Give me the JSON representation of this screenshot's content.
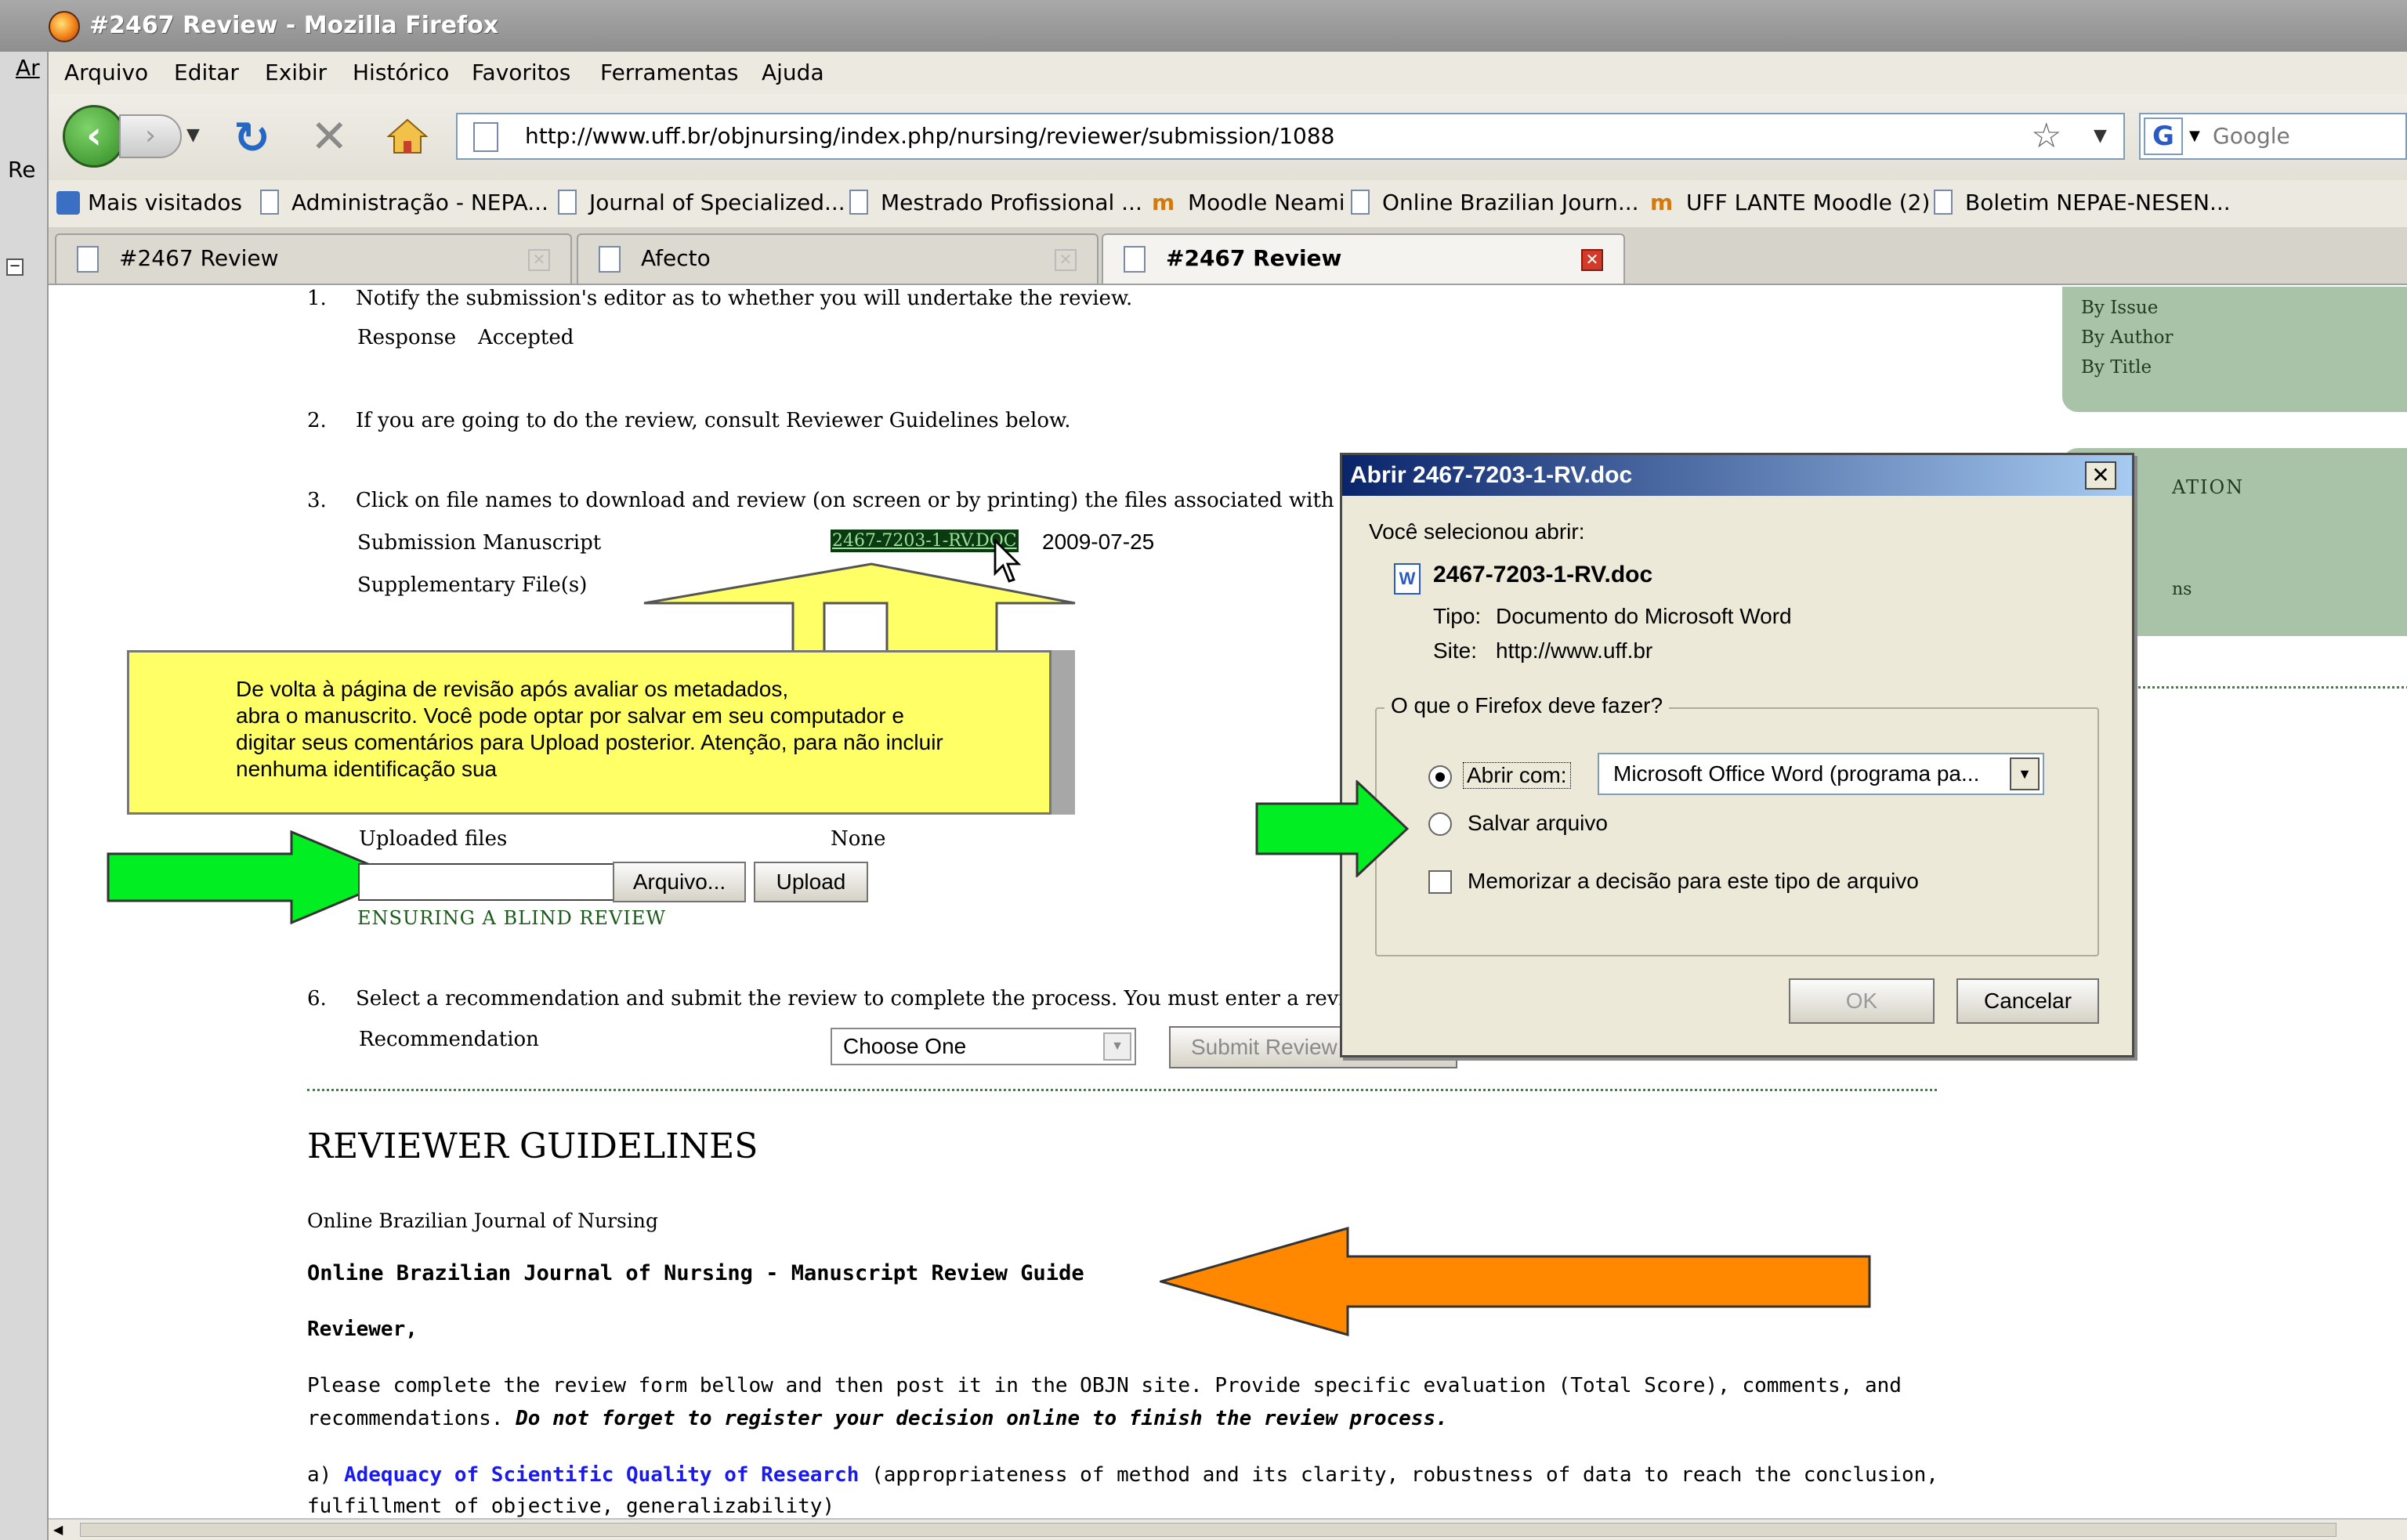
{
  "window": {
    "title": "#2467 Review - Mozilla Firefox"
  },
  "left_strip": {
    "top_label": "Ar",
    "side_label": "Re"
  },
  "menu": [
    "Arquivo",
    "Editar",
    "Exibir",
    "Histórico",
    "Favoritos",
    "Ferramentas",
    "Ajuda"
  ],
  "url": "http://www.uff.br/objnursing/index.php/nursing/reviewer/submission/1088",
  "search": {
    "placeholder": "Google"
  },
  "bookmarks": [
    "Mais visitados",
    "Administração - NEPA...",
    "Journal of Specialized...",
    "Mestrado Profissional ...",
    "Moodle Neami",
    "Online Brazilian Journ...",
    "UFF LANTE Moodle (2)",
    "Boletim NEPAE-NESEN..."
  ],
  "tabs": [
    {
      "label": "#2467 Review",
      "active": false
    },
    {
      "label": "Afecto",
      "active": false
    },
    {
      "label": "#2467 Review",
      "active": true
    }
  ],
  "page": {
    "step1": {
      "num": "1.",
      "text": "Notify the submission's editor as to whether you will undertake the review.",
      "response_label": "Response",
      "response_value": "Accepted"
    },
    "step2": {
      "num": "2.",
      "text": "If you are going to do the review, consult Reviewer Guidelines below."
    },
    "step3": {
      "num": "3.",
      "text": "Click on file names to download and review (on screen or by printing) the files associated with this sub",
      "manuscript_label": "Submission Manuscript",
      "manuscript_file": "2467-7203-1-RV.DOC",
      "manuscript_date": "2009-07-25",
      "supplementary_label": "Supplementary File(s)"
    },
    "callout_text": [
      "De volta à página de revisão após avaliar os metadados,",
      "abra o manuscrito. Você pode optar por salvar em seu computador e",
      "digitar seus comentários para Upload posterior. Atenção, para não incluir",
      "nenhuma identificação sua"
    ],
    "upload": {
      "label": "Uploaded files",
      "value": "None",
      "browse_label": "Arquivo...",
      "upload_label": "Upload",
      "blind_review_link": "ENSURING A BLIND REVIEW"
    },
    "step6": {
      "num": "6.",
      "text": "Select a recommendation and submit the review to complete the process. You must enter a review or u",
      "recommendation_label": "Recommendation",
      "select_value": "Choose One",
      "submit_label": "Submit Review"
    },
    "guidelines": {
      "heading": "REVIEWER GUIDELINES",
      "journal": "Online Brazilian Journal of Nursing",
      "guide_title": "Online Brazilian Journal of Nursing - Manuscript Review Guide",
      "reviewer": "Reviewer,",
      "para1": "Please complete the review form bellow and then post it in the OBJN site. Provide specific evaluation (Total Score), comments, and",
      "para2_plain": "recommendations. ",
      "para2_bold": "Do not forget to register your decision online to finish the review process.",
      "item_a_prefix": "a) ",
      "item_a_link": "Adequacy of Scientific Quality of Research",
      "item_a_rest": " (appropriateness of method and its clarity, robustness of data to reach the conclusion,",
      "item_a_line2": "fulfillment of objective, generalizability)"
    },
    "sidebar": {
      "links": [
        "By Issue",
        "By Author",
        "By Title"
      ],
      "heading_fragment": "ATION",
      "link_fragment": "ns"
    }
  },
  "dialog": {
    "title": "Abrir 2467-7203-1-RV.doc",
    "selected_label": "Você selecionou abrir:",
    "filename": "2467-7203-1-RV.doc",
    "type_label": "Tipo:",
    "type_value": "Documento do Microsoft Word",
    "site_label": "Site:",
    "site_value": "http://www.uff.br",
    "group_label": "O que o Firefox deve fazer?",
    "open_with_label": "Abrir com:",
    "open_with_value": "Microsoft Office Word (programa pa...",
    "save_label": "Salvar arquivo",
    "remember_label": "Memorizar a decisão para este tipo de arquivo",
    "ok_label": "OK",
    "cancel_label": "Cancelar",
    "open_with_selected": true,
    "remember_checked": false
  },
  "colors": {
    "callout_yellow": "#ffff66",
    "arrow_green": "#00ee22",
    "arrow_orange": "#ff8800",
    "sidebar_green": "#a9c3a9",
    "link_blue": "#1a1aee",
    "dialog_title": "#0a246a"
  }
}
